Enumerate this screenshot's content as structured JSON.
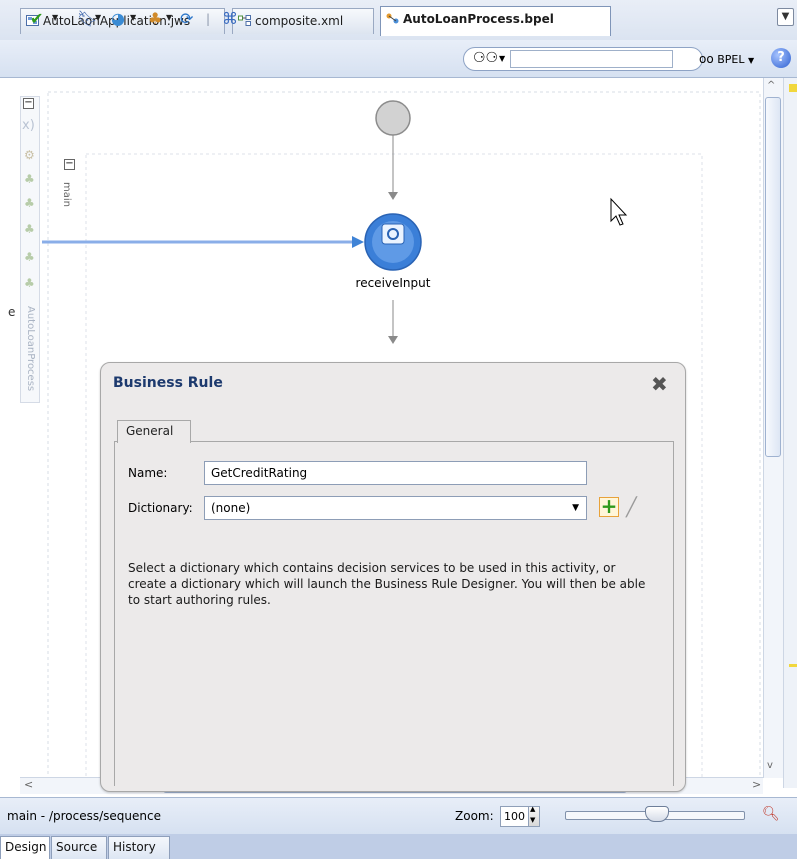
{
  "editor_tabs": [
    {
      "label": "AutoLaonApplication.jws",
      "active": false
    },
    {
      "label": "composite.xml",
      "active": false
    },
    {
      "label": "AutoLoanProcess.bpel",
      "active": true
    }
  ],
  "toolbar": {
    "search_placeholder": "",
    "bpel_menu_label": "BPEL",
    "help_glyph": "?"
  },
  "diagram": {
    "scope_label": "main",
    "process_label": "AutoLoanProcess",
    "receive_activity_label": "receiveInput",
    "left_edge_char": "e"
  },
  "business_rule_dialog": {
    "title": "Business Rule",
    "tab_general": "General",
    "name_label": "Name:",
    "name_value": "GetCreditRating",
    "dictionary_label": "Dictionary:",
    "dictionary_value": "(none)",
    "help_text": "Select a dictionary which contains decision services to be used in this activity, or create a dictionary which will launch the Business Rule Designer. You will then be able to start authoring rules."
  },
  "status_bar": {
    "path": "main - /process/sequence",
    "zoom_label": "Zoom:",
    "zoom_value": "100"
  },
  "bottom_tabs": [
    {
      "label": "Design",
      "active": true
    },
    {
      "label": "Source",
      "active": false
    },
    {
      "label": "History",
      "active": false
    }
  ],
  "colors": {
    "accent": "#3f83d6",
    "connector": "#8aaee8",
    "panel_bg": "#eceaea"
  }
}
